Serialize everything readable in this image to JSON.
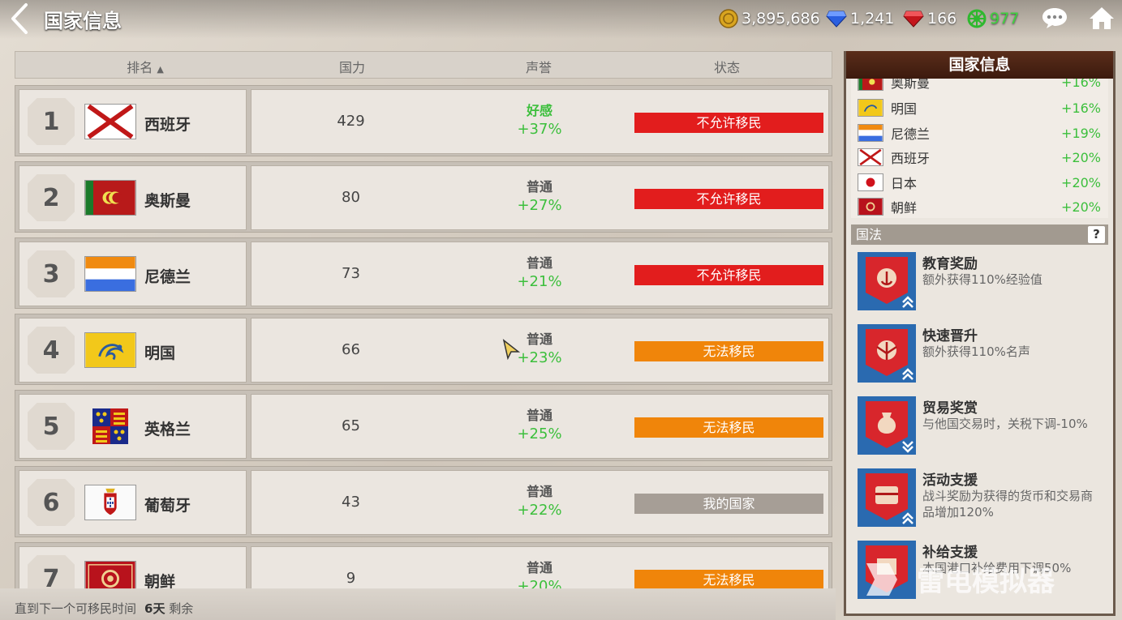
{
  "header": {
    "title": "国家信息"
  },
  "currencies": [
    {
      "name": "gold-coin-icon",
      "value": "3,895,686"
    },
    {
      "name": "blue-gem-icon",
      "value": "1,241"
    },
    {
      "name": "red-gem-icon",
      "value": "166"
    },
    {
      "name": "green-wheel-icon",
      "value": "977"
    }
  ],
  "table": {
    "columns": {
      "rank": "排名",
      "power": "国力",
      "reputation": "声誉",
      "status": "状态"
    },
    "rows": [
      {
        "rank": "1",
        "country": "西班牙",
        "flag": "spain",
        "power": "429",
        "rep_label": "好感",
        "rep_value": "+37%",
        "status": "不允许移民",
        "status_type": "red"
      },
      {
        "rank": "2",
        "country": "奥斯曼",
        "flag": "ottoman",
        "power": "80",
        "rep_label": "普通",
        "rep_value": "+27%",
        "status": "不允许移民",
        "status_type": "red"
      },
      {
        "rank": "3",
        "country": "尼德兰",
        "flag": "netherlands",
        "power": "73",
        "rep_label": "普通",
        "rep_value": "+21%",
        "status": "不允许移民",
        "status_type": "red"
      },
      {
        "rank": "4",
        "country": "明国",
        "flag": "ming",
        "power": "66",
        "rep_label": "普通",
        "rep_value": "+23%",
        "status": "无法移民",
        "status_type": "orange"
      },
      {
        "rank": "5",
        "country": "英格兰",
        "flag": "england",
        "power": "65",
        "rep_label": "普通",
        "rep_value": "+25%",
        "status": "无法移民",
        "status_type": "orange"
      },
      {
        "rank": "6",
        "country": "葡萄牙",
        "flag": "portugal",
        "power": "43",
        "rep_label": "普通",
        "rep_value": "+22%",
        "status": "我的国家",
        "status_type": "gray"
      },
      {
        "rank": "7",
        "country": "朝鲜",
        "flag": "joseon",
        "power": "9",
        "rep_label": "普通",
        "rep_value": "+20%",
        "status": "无法移民",
        "status_type": "orange"
      }
    ]
  },
  "footer": {
    "label": "直到下一个可移民时间",
    "days": "6天",
    "suffix": "剩余"
  },
  "side": {
    "title": "国家信息",
    "list": [
      {
        "country": "奥斯曼",
        "flag": "ottoman",
        "pct": "+16%"
      },
      {
        "country": "明国",
        "flag": "ming",
        "pct": "+16%"
      },
      {
        "country": "尼德兰",
        "flag": "netherlands",
        "pct": "+19%"
      },
      {
        "country": "西班牙",
        "flag": "spain",
        "pct": "+20%"
      },
      {
        "country": "日本",
        "flag": "japan",
        "pct": "+20%"
      },
      {
        "country": "朝鲜",
        "flag": "joseon",
        "pct": "+20%"
      }
    ],
    "law_title": "国法",
    "help": "?",
    "laws": [
      {
        "title": "教育奖励",
        "desc": "额外获得110%经验值",
        "icon": "anchor-medal-icon"
      },
      {
        "title": "快速晋升",
        "desc": "额外获得110%名声",
        "icon": "eagle-crest-icon"
      },
      {
        "title": "贸易奖赏",
        "desc": "与他国交易时，关税下调-10%",
        "icon": "money-bag-icon"
      },
      {
        "title": "活动支援",
        "desc": "战斗奖励为获得的货币和交易商品增加120%",
        "icon": "treasure-chest-icon"
      },
      {
        "title": "补给支援",
        "desc": "本国港口补给费用下调50%",
        "icon": "supply-icon"
      }
    ]
  },
  "watermark": "雷电模拟器",
  "colors": {
    "red": "#e21d1d",
    "orange": "#f0850a",
    "gray": "#a69e96",
    "green": "#3cbf3c"
  }
}
